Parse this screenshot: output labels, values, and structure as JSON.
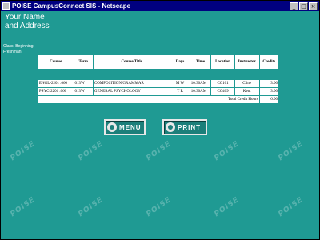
{
  "window": {
    "title": "POISE CampusConnect SIS - Netscape",
    "buttons": [
      "_",
      "□",
      "×"
    ]
  },
  "user": {
    "name": "Your Name",
    "address": "and Address",
    "class_line": "Class: Beginning",
    "class_value": "Freshman"
  },
  "watermark": "POISE",
  "schedule": {
    "headers": [
      "Course",
      "Term",
      "Course Title",
      "Days",
      "Time",
      "Location",
      "Instructor",
      "Credits"
    ],
    "rows": [
      [
        "ENGL-2201 .060",
        "013W",
        "COMPOSITION/GRAMMAR",
        "M W",
        "10:30AM",
        "CC101",
        "Cline",
        "3.00"
      ],
      [
        "PSYC-2201 .060",
        "013W",
        "GENERAL PSYCHOLOGY",
        "T R",
        "10:30AM",
        "CC409",
        "Kent",
        "3.00"
      ]
    ],
    "total_label": "Total Credit Hours",
    "total_value": "6.00"
  },
  "actions": {
    "menu": "MENU",
    "print": "PRINT"
  },
  "colors": {
    "background": "#1f9a93",
    "titlebar": "#000080"
  }
}
